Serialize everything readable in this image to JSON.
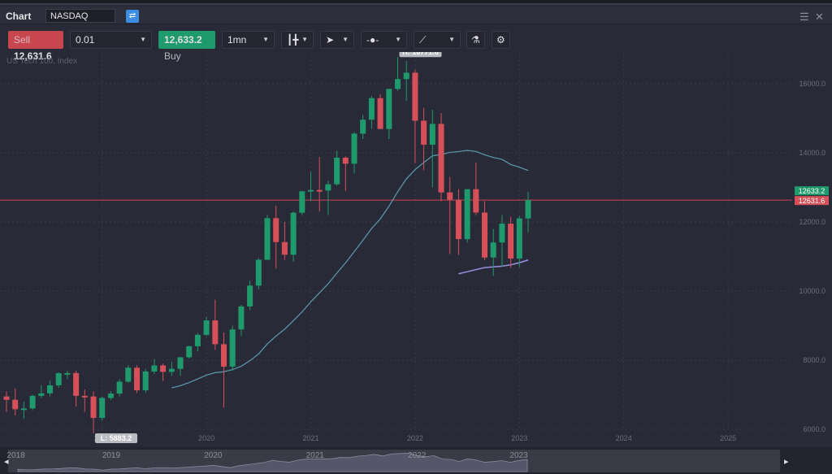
{
  "window": {
    "title": "Chart",
    "symbol": "NASDAQ",
    "menu_icon": "hamburger-icon",
    "close_icon": "close-icon"
  },
  "toolbar": {
    "sell_label": "Sell",
    "sell_price": "12,631.6",
    "quantity": "0.01",
    "buy_price": "12,633.2",
    "buy_label": "Buy",
    "timeframe": "1mn",
    "chart_type_icon": "candlestick-icon",
    "cursor_icon": "cursor-icon",
    "time_icon": "clock-icon",
    "draw_icon": "trendline-icon",
    "indicator_icon": "flask-icon",
    "settings_icon": "gear-icon"
  },
  "instrument_label": "US Tech 100, Index",
  "colors": {
    "up": "#1f9a6c",
    "down": "#d6505a",
    "ma": "#5b9bb0",
    "secondary": "#9a8fe0",
    "price_line": "#c8474f"
  },
  "chart_data": {
    "type": "candlestick",
    "interval": "monthly",
    "ylim": [
      6000,
      16500
    ],
    "yticks": [
      6000,
      8000,
      10000,
      12000,
      14000,
      16000
    ],
    "ytick_labels": [
      "6000.0",
      "8000.0",
      "10000.0",
      "12000.0",
      "14000.0",
      "16000.0"
    ],
    "xticks": [
      "2019",
      "2020",
      "2021",
      "2022",
      "2023",
      "2024",
      "2025"
    ],
    "grid": true,
    "high_label": "H: 16771.6",
    "low_label": "L: 5883.2",
    "ask_label": "12633.2",
    "bid_label": "12631.6",
    "bid": 12631.6,
    "ask": 12633.2,
    "columns": [
      "date",
      "open",
      "high",
      "low",
      "close"
    ],
    "candles": [
      [
        "2018-02",
        6950,
        7100,
        6500,
        6854
      ],
      [
        "2018-03",
        6854,
        7180,
        6400,
        6581
      ],
      [
        "2018-04",
        6581,
        6800,
        6300,
        6605
      ],
      [
        "2018-05",
        6605,
        7000,
        6550,
        6967
      ],
      [
        "2018-06",
        6967,
        7280,
        6900,
        7040
      ],
      [
        "2018-07",
        7040,
        7400,
        6950,
        7272
      ],
      [
        "2018-08",
        7272,
        7650,
        7200,
        7623
      ],
      [
        "2018-09",
        7623,
        7700,
        7450,
        7627
      ],
      [
        "2018-10",
        7627,
        7700,
        6650,
        6968
      ],
      [
        "2018-11",
        6968,
        7150,
        6500,
        6949
      ],
      [
        "2018-12",
        6949,
        7100,
        5883.2,
        6330
      ],
      [
        "2019-01",
        6330,
        6950,
        6250,
        6906
      ],
      [
        "2019-02",
        6906,
        7100,
        6850,
        7033
      ],
      [
        "2019-03",
        7033,
        7450,
        6950,
        7378
      ],
      [
        "2019-04",
        7378,
        7850,
        7350,
        7781
      ],
      [
        "2019-05",
        7781,
        7850,
        7050,
        7128
      ],
      [
        "2019-06",
        7128,
        7750,
        7050,
        7672
      ],
      [
        "2019-07",
        7672,
        8030,
        7600,
        7848
      ],
      [
        "2019-08",
        7848,
        7900,
        7400,
        7663
      ],
      [
        "2019-09",
        7663,
        7950,
        7550,
        7749
      ],
      [
        "2019-10",
        7749,
        8100,
        7550,
        8083
      ],
      [
        "2019-11",
        8083,
        8420,
        8050,
        8403
      ],
      [
        "2019-12",
        8403,
        8780,
        8250,
        8733
      ],
      [
        "2020-01",
        8733,
        9250,
        8700,
        9150
      ],
      [
        "2020-02",
        9150,
        9750,
        8300,
        8462
      ],
      [
        "2020-03",
        8462,
        8800,
        6631,
        7813
      ],
      [
        "2020-04",
        7813,
        9000,
        7700,
        8890
      ],
      [
        "2020-05",
        8890,
        9600,
        8700,
        9555
      ],
      [
        "2020-06",
        9555,
        10300,
        9450,
        10157
      ],
      [
        "2020-07",
        10157,
        10950,
        10050,
        10906
      ],
      [
        "2020-08",
        10906,
        12200,
        10900,
        12110
      ],
      [
        "2020-09",
        12110,
        12470,
        10650,
        11418
      ],
      [
        "2020-10",
        11418,
        12000,
        10900,
        11052
      ],
      [
        "2020-11",
        11052,
        12300,
        10850,
        12268
      ],
      [
        "2020-12",
        12268,
        12900,
        12200,
        12888
      ],
      [
        "2021-01",
        12888,
        13450,
        12600,
        12925
      ],
      [
        "2021-02",
        12925,
        13880,
        12300,
        12909
      ],
      [
        "2021-03",
        12909,
        13200,
        12200,
        13091
      ],
      [
        "2021-04",
        13091,
        14060,
        13050,
        13861
      ],
      [
        "2021-05",
        13861,
        13900,
        12900,
        13686
      ],
      [
        "2021-06",
        13686,
        14600,
        13400,
        14555
      ],
      [
        "2021-07",
        14555,
        15100,
        14400,
        14960
      ],
      [
        "2021-08",
        14960,
        15650,
        14700,
        15583
      ],
      [
        "2021-09",
        15583,
        15700,
        14700,
        14690
      ],
      [
        "2021-10",
        14690,
        15850,
        14400,
        15850
      ],
      [
        "2021-11",
        15850,
        16771.6,
        15800,
        16135
      ],
      [
        "2021-12",
        16135,
        16660,
        15500,
        16320
      ],
      [
        "2022-01",
        16320,
        16400,
        13700,
        14930
      ],
      [
        "2022-02",
        14930,
        15300,
        13500,
        14237
      ],
      [
        "2022-03",
        14237,
        15250,
        13000,
        14838
      ],
      [
        "2022-04",
        14838,
        15150,
        12600,
        12855
      ],
      [
        "2022-05",
        12855,
        13300,
        11070,
        12643
      ],
      [
        "2022-06",
        12643,
        12950,
        11040,
        11504
      ],
      [
        "2022-07",
        11504,
        12950,
        11400,
        12948
      ],
      [
        "2022-08",
        12948,
        13720,
        12200,
        12272
      ],
      [
        "2022-09",
        12272,
        12600,
        10900,
        10972
      ],
      [
        "2022-10",
        10972,
        11800,
        10440,
        11406
      ],
      [
        "2022-11",
        11406,
        12200,
        10700,
        11951
      ],
      [
        "2022-12",
        11951,
        12150,
        10670,
        10940
      ],
      [
        "2023-01",
        10940,
        12170,
        10690,
        12102
      ],
      [
        "2023-02",
        12102,
        12880,
        11700,
        12633.2
      ]
    ],
    "moving_average_period": 20,
    "secondary_line": {
      "start": "2022-06",
      "values": [
        10500,
        10560,
        10620,
        10680,
        10700,
        10720,
        10760,
        10820,
        10900
      ]
    }
  },
  "navigator": {
    "labels": [
      "2018",
      "2019",
      "2020",
      "2021",
      "2022",
      "2023"
    ]
  }
}
